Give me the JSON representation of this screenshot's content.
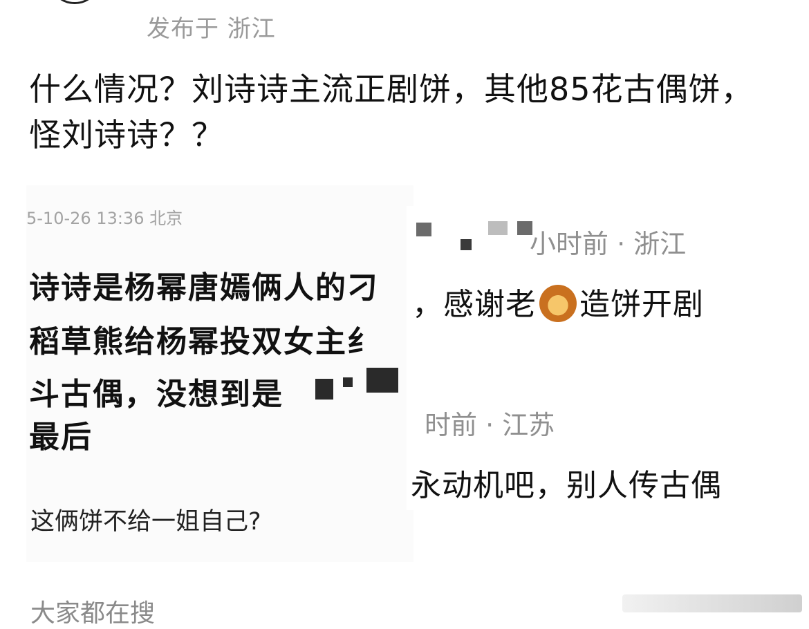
{
  "post": {
    "location": "发布于 浙江",
    "body": "什么情况？刘诗诗主流正剧饼，其他85花古偶饼，怪刘诗诗？？"
  },
  "left_screenshot": {
    "meta": "5-10-26 13:36 北京",
    "lines": [
      "诗诗是杨幂唐嫣俩人的刁",
      "稻草熊给杨幂投双女主纟",
      "斗古偶，没想到是",
      "最后"
    ],
    "reply": "这俩饼不给一姐自己?"
  },
  "right_screenshot": {
    "comment1_meta": "小时前 · 浙江",
    "comment1_text_before": "，感谢老",
    "comment1_emoji": "lion-emoji",
    "comment1_text_after": "造饼开剧",
    "comment2_meta": "时前 · 江苏",
    "comment2_text": "永动机吧，别人传古偶"
  },
  "footer": {
    "trending_label": "大家都在搜"
  },
  "colors": {
    "meta_grey": "#9a9a9a",
    "text": "#111111",
    "badge_orange": "#f08a24"
  }
}
